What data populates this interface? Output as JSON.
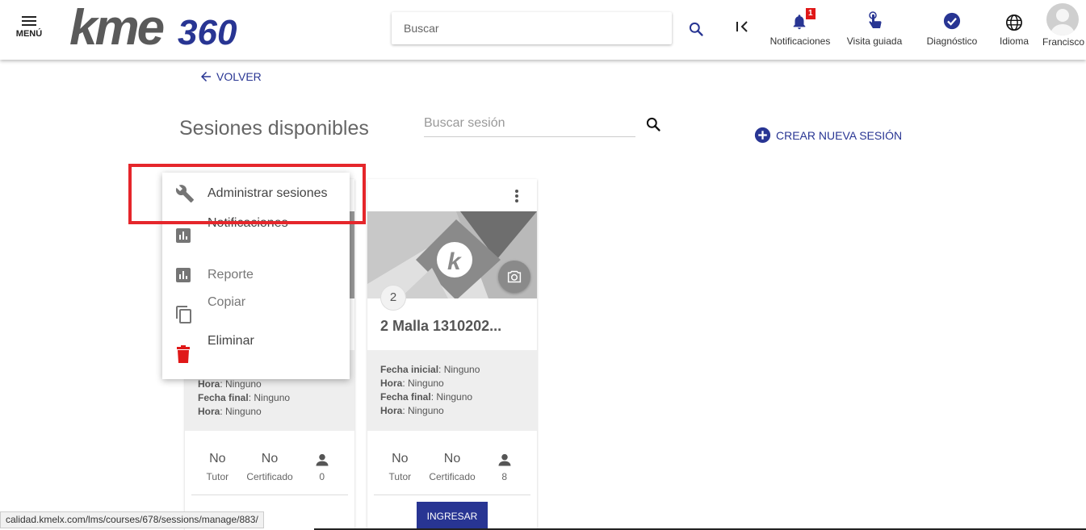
{
  "header": {
    "menu_label": "MENÚ",
    "logo_text": "kme360",
    "search_placeholder": "Buscar",
    "notifications": {
      "label": "Notificaciones",
      "badge": "1"
    },
    "guided_visit": "Visita guiada",
    "diagnostic": "Diagnóstico",
    "language": "Idioma",
    "user": "Francisco",
    "colors": {
      "accent": "#283593",
      "badge": "#e01818"
    }
  },
  "main": {
    "back_label": "VOLVER",
    "title": "Sesiones disponibles",
    "session_search_placeholder": "Buscar sesión",
    "create_label": "CREAR NUEVA SESIÓN"
  },
  "dropdown": {
    "items": [
      {
        "label": "Administrar sesiones",
        "icon": "wrench-icon"
      },
      {
        "label": "Notificaciones",
        "icon": "bar-chart-icon"
      },
      {
        "label": "Reporte",
        "icon": "bar-chart-icon"
      },
      {
        "label": "Copiar",
        "icon": "copy-icon"
      },
      {
        "label": "Eliminar",
        "icon": "trash-icon"
      }
    ],
    "highlight_color": "#e5262b"
  },
  "cards": [
    {
      "info": [
        {
          "k": "Hora",
          "v": "Ninguno"
        },
        {
          "k": "Fecha final",
          "v": "Ninguno"
        },
        {
          "k": "Hora",
          "v": "Ninguno"
        }
      ],
      "stats": [
        {
          "value": "No",
          "label": "Tutor"
        },
        {
          "value": "No",
          "label": "Certificado"
        },
        {
          "value": "",
          "label": "0"
        }
      ]
    },
    {
      "number": "2",
      "title": "2 Malla 1310202...",
      "info": [
        {
          "k": "Fecha inicial",
          "v": "Ninguno"
        },
        {
          "k": "Hora",
          "v": "Ninguno"
        },
        {
          "k": "Fecha final",
          "v": "Ninguno"
        },
        {
          "k": "Hora",
          "v": "Ninguno"
        }
      ],
      "stats": [
        {
          "value": "No",
          "label": "Tutor"
        },
        {
          "value": "No",
          "label": "Certificado"
        },
        {
          "value": "",
          "label": "8"
        }
      ],
      "button_label": "INGRESAR"
    }
  ],
  "statusbar": {
    "url": "calidad.kmelx.com/lms/courses/678/sessions/manage/883/"
  }
}
